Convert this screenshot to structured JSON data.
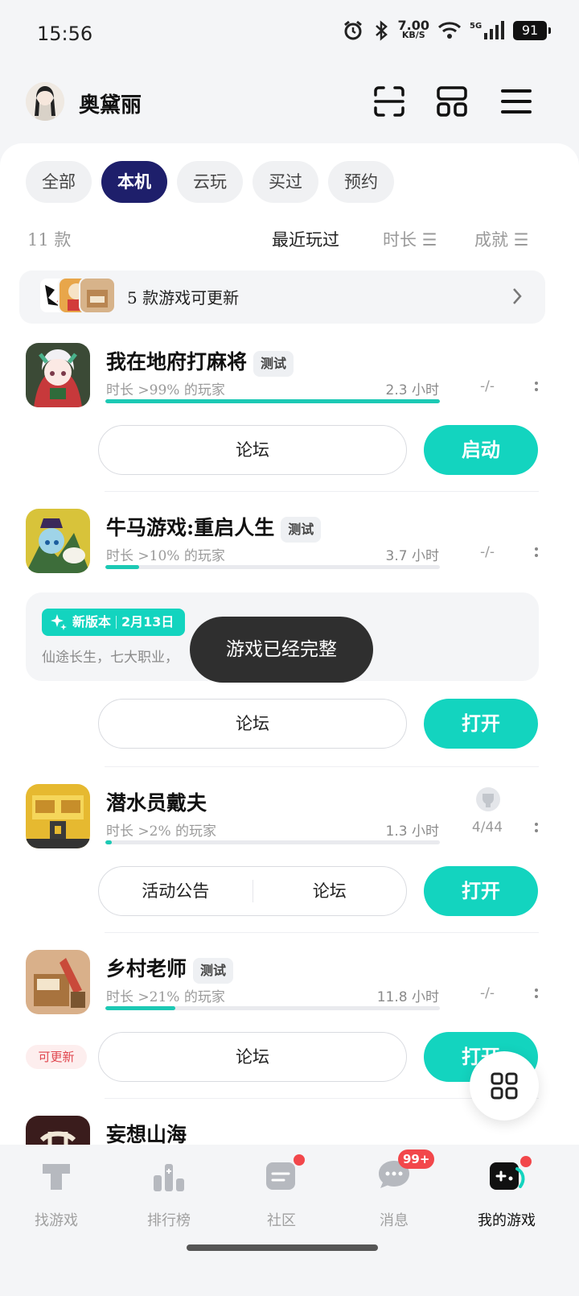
{
  "status_bar": {
    "time": "15:56",
    "net_speed_value": "7.00",
    "net_speed_unit": "KB/S",
    "network": "5G",
    "battery": "91"
  },
  "header": {
    "user_name": "奥黛丽",
    "icons": [
      "scan-icon",
      "grid-layout-icon",
      "menu-icon"
    ]
  },
  "tabs": [
    {
      "label": "全部",
      "active": false
    },
    {
      "label": "本机",
      "active": true
    },
    {
      "label": "云玩",
      "active": false
    },
    {
      "label": "买过",
      "active": false
    },
    {
      "label": "预约",
      "active": false
    }
  ],
  "sort": {
    "count": "11 款",
    "recent": "最近玩过",
    "duration": "时长 ☰",
    "achievement": "成就 ☰"
  },
  "update_bar": {
    "text": "5 款游戏可更新"
  },
  "games": [
    {
      "title": "我在地府打麻将",
      "badge": "测试",
      "sub": "时长 >99% 的玩家",
      "hours": "2.3 小时",
      "progress": 1.0,
      "achievement": "-/-",
      "buttons": [
        "论坛"
      ],
      "primary": "启动"
    },
    {
      "title": "牛马游戏:重启人生",
      "badge": "测试",
      "sub": "时长 >10% 的玩家",
      "hours": "3.7 小时",
      "progress": 0.1,
      "achievement": "-/-",
      "news": {
        "badge_left": "新版本",
        "badge_right": "2月13日",
        "text": "仙途长生，七大职业，"
      },
      "buttons": [
        "论坛"
      ],
      "primary": "打开"
    },
    {
      "title": "潜水员戴夫",
      "badge": "",
      "sub": "时长 >2% 的玩家",
      "hours": "1.3 小时",
      "progress": 0.02,
      "achievement": "4/44",
      "buttons": [
        "活动公告",
        "论坛"
      ],
      "primary": "打开"
    },
    {
      "title": "乡村老师",
      "badge": "测试",
      "sub": "时长 >21% 的玩家",
      "hours": "11.8 小时",
      "progress": 0.21,
      "achievement": "-/-",
      "tag": "可更新",
      "buttons": [
        "论坛"
      ],
      "primary": "打开"
    },
    {
      "title": "妄想山海"
    }
  ],
  "toast": "游戏已经完整",
  "bottom_nav": [
    {
      "label": "找游戏",
      "icon": "find-game-icon"
    },
    {
      "label": "排行榜",
      "icon": "ranking-icon"
    },
    {
      "label": "社区",
      "icon": "community-icon"
    },
    {
      "label": "消息",
      "icon": "message-icon",
      "badge": "99+"
    },
    {
      "label": "我的游戏",
      "icon": "my-games-icon",
      "active": true
    }
  ],
  "colors": {
    "accent": "#13d4bf",
    "tab_active": "#1e1f6b",
    "badge_red": "#f2474b"
  }
}
